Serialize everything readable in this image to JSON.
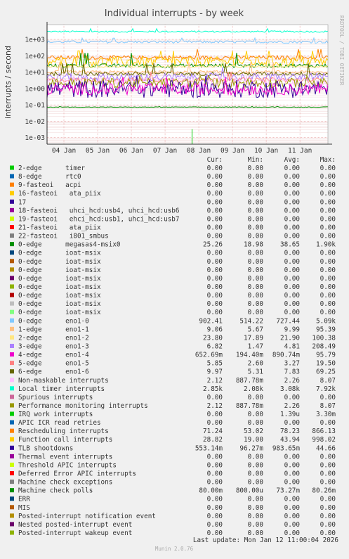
{
  "chart_data": {
    "type": "line",
    "title": "Individual interrupts - by week",
    "ylabel": "interrupts / second",
    "y_scale": "log",
    "ylim": [
      0.0004,
      8000
    ],
    "y_ticks": [
      {
        "value": 1000,
        "label": "1e+03"
      },
      {
        "value": 100,
        "label": "1e+02"
      },
      {
        "value": 10,
        "label": "1e+01"
      },
      {
        "value": 1,
        "label": "1e+00"
      },
      {
        "value": 0.1,
        "label": "1e-01"
      },
      {
        "value": 0.01,
        "label": "1e-02"
      },
      {
        "value": 0.001,
        "label": "1e-03"
      }
    ],
    "x_ticks": [
      {
        "value": 0.5,
        "label": "04 Jan"
      },
      {
        "value": 1.5,
        "label": "05 Jan"
      },
      {
        "value": 2.5,
        "label": "06 Jan"
      },
      {
        "value": 3.5,
        "label": "07 Jan"
      },
      {
        "value": 4.5,
        "label": "08 Jan"
      },
      {
        "value": 5.5,
        "label": "09 Jan"
      },
      {
        "value": 6.5,
        "label": "10 Jan"
      },
      {
        "value": 7.5,
        "label": "11 Jan"
      }
    ],
    "xlim": [
      0,
      8.33
    ],
    "grid": true,
    "side_label": "RRDTOOL / TOBI OETIKER",
    "column_headers": [
      "Cur:",
      "Min:",
      "Avg:",
      "Max:"
    ],
    "series": [
      {
        "name": "2-edge      timer",
        "color": "#00cc00",
        "cur": "0.00",
        "min": "0.00",
        "avg": "0.00",
        "max": "0.00"
      },
      {
        "name": "8-edge      rtc0",
        "color": "#0066b3",
        "cur": "0.00",
        "min": "0.00",
        "avg": "0.00",
        "max": "0.00"
      },
      {
        "name": "9-fasteoi   acpi",
        "color": "#ff8000",
        "cur": "0.00",
        "min": "0.00",
        "avg": "0.00",
        "max": "0.00"
      },
      {
        "name": "16-fasteoi   ata_piix",
        "color": "#ffcc00",
        "cur": "0.00",
        "min": "0.00",
        "avg": "0.00",
        "max": "0.00"
      },
      {
        "name": "17",
        "color": "#330099",
        "cur": "0.00",
        "min": "0.00",
        "avg": "0.00",
        "max": "0.00"
      },
      {
        "name": "18-fasteoi   uhci_hcd:usb4, uhci_hcd:usb6",
        "color": "#990099",
        "cur": "0.00",
        "min": "0.00",
        "avg": "0.00",
        "max": "0.00"
      },
      {
        "name": "19-fasteoi   ehci_hcd:usb1, uhci_hcd:usb7",
        "color": "#ccff00",
        "cur": "0.00",
        "min": "0.00",
        "avg": "0.00",
        "max": "0.00"
      },
      {
        "name": "21-fasteoi   ata_piix",
        "color": "#ff0000",
        "cur": "0.00",
        "min": "0.00",
        "avg": "0.00",
        "max": "0.00"
      },
      {
        "name": "22-fasteoi   i801_smbus",
        "color": "#808080",
        "cur": "0.00",
        "min": "0.00",
        "avg": "0.00",
        "max": "0.00"
      },
      {
        "name": "0-edge      megasas4-msix0",
        "color": "#008f00",
        "cur": "25.26",
        "min": "18.98",
        "avg": "38.65",
        "max": "1.90k"
      },
      {
        "name": "0-edge      ioat-msix",
        "color": "#00487d",
        "cur": "0.00",
        "min": "0.00",
        "avg": "0.00",
        "max": "0.00"
      },
      {
        "name": "0-edge      ioat-msix",
        "color": "#b35a00",
        "cur": "0.00",
        "min": "0.00",
        "avg": "0.00",
        "max": "0.00"
      },
      {
        "name": "0-edge      ioat-msix",
        "color": "#b38f00",
        "cur": "0.00",
        "min": "0.00",
        "avg": "0.00",
        "max": "0.00"
      },
      {
        "name": "0-edge      ioat-msix",
        "color": "#6b006b",
        "cur": "0.00",
        "min": "0.00",
        "avg": "0.00",
        "max": "0.00"
      },
      {
        "name": "0-edge      ioat-msix",
        "color": "#8fb300",
        "cur": "0.00",
        "min": "0.00",
        "avg": "0.00",
        "max": "0.00"
      },
      {
        "name": "0-edge      ioat-msix",
        "color": "#b30000",
        "cur": "0.00",
        "min": "0.00",
        "avg": "0.00",
        "max": "0.00"
      },
      {
        "name": "0-edge      ioat-msix",
        "color": "#bebebe",
        "cur": "0.00",
        "min": "0.00",
        "avg": "0.00",
        "max": "0.00"
      },
      {
        "name": "0-edge      ioat-msix",
        "color": "#80ff80",
        "cur": "0.00",
        "min": "0.00",
        "avg": "0.00",
        "max": "0.00"
      },
      {
        "name": "0-edge      eno1-0",
        "color": "#80c9ff",
        "cur": "902.41",
        "min": "514.22",
        "avg": "727.44",
        "max": "5.09k"
      },
      {
        "name": "1-edge      eno1-1",
        "color": "#ffc080",
        "cur": "9.06",
        "min": "5.67",
        "avg": "9.99",
        "max": "95.39"
      },
      {
        "name": "2-edge      eno1-2",
        "color": "#ffe680",
        "cur": "23.80",
        "min": "17.89",
        "avg": "21.90",
        "max": "100.38"
      },
      {
        "name": "3-edge      eno1-3",
        "color": "#aa80ff",
        "cur": "6.82",
        "min": "1.47",
        "avg": "4.81",
        "max": "208.49"
      },
      {
        "name": "4-edge      eno1-4",
        "color": "#ee00cc",
        "cur": "652.69m",
        "min": "194.40m",
        "avg": "890.74m",
        "max": "95.79"
      },
      {
        "name": "5-edge      eno1-5",
        "color": "#ff8080",
        "cur": "5.85",
        "min": "2.60",
        "avg": "3.27",
        "max": "19.50"
      },
      {
        "name": "6-edge      eno1-6",
        "color": "#666600",
        "cur": "9.97",
        "min": "5.31",
        "avg": "7.83",
        "max": "69.25"
      },
      {
        "name": "Non-maskable interrupts",
        "color": "#ffbfff",
        "cur": "2.12",
        "min": "887.78m",
        "avg": "2.26",
        "max": "8.07"
      },
      {
        "name": "Local timer interrupts",
        "color": "#00ffcc",
        "cur": "2.85k",
        "min": "2.08k",
        "avg": "3.08k",
        "max": "7.92k"
      },
      {
        "name": "Spurious interrupts",
        "color": "#cc6699",
        "cur": "0.00",
        "min": "0.00",
        "avg": "0.00",
        "max": "0.00"
      },
      {
        "name": "Performance monitoring interrupts",
        "color": "#999900",
        "cur": "2.12",
        "min": "887.78m",
        "avg": "2.26",
        "max": "8.07"
      },
      {
        "name": "IRQ work interrupts",
        "color": "#00cc00",
        "cur": "0.00",
        "min": "0.00",
        "avg": "1.39u",
        "max": "3.30m"
      },
      {
        "name": "APIC ICR read retries",
        "color": "#0066b3",
        "cur": "0.00",
        "min": "0.00",
        "avg": "0.00",
        "max": "0.00"
      },
      {
        "name": "Rescheduling interrupts",
        "color": "#ff8000",
        "cur": "71.24",
        "min": "53.02",
        "avg": "78.23",
        "max": "866.13"
      },
      {
        "name": "Function call interrupts",
        "color": "#ffcc00",
        "cur": "28.82",
        "min": "19.00",
        "avg": "43.94",
        "max": "998.02"
      },
      {
        "name": "TLB shootdowns",
        "color": "#330099",
        "cur": "553.14m",
        "min": "96.27m",
        "avg": "983.65m",
        "max": "44.66"
      },
      {
        "name": "Thermal event interrupts",
        "color": "#990099",
        "cur": "0.00",
        "min": "0.00",
        "avg": "0.00",
        "max": "0.00"
      },
      {
        "name": "Threshold APIC interrupts",
        "color": "#ccff00",
        "cur": "0.00",
        "min": "0.00",
        "avg": "0.00",
        "max": "0.00"
      },
      {
        "name": "Deferred Error APIC interrupts",
        "color": "#ff0000",
        "cur": "0.00",
        "min": "0.00",
        "avg": "0.00",
        "max": "0.00"
      },
      {
        "name": "Machine check exceptions",
        "color": "#808080",
        "cur": "0.00",
        "min": "0.00",
        "avg": "0.00",
        "max": "0.00"
      },
      {
        "name": "Machine check polls",
        "color": "#008f00",
        "cur": "80.00m",
        "min": "800.00u",
        "avg": "73.27m",
        "max": "80.26m"
      },
      {
        "name": "ERR",
        "color": "#00487d",
        "cur": "0.00",
        "min": "0.00",
        "avg": "0.00",
        "max": "0.00"
      },
      {
        "name": "MIS",
        "color": "#b35a00",
        "cur": "0.00",
        "min": "0.00",
        "avg": "0.00",
        "max": "0.00"
      },
      {
        "name": "Posted-interrupt notification event",
        "color": "#b38f00",
        "cur": "0.00",
        "min": "0.00",
        "avg": "0.00",
        "max": "0.00"
      },
      {
        "name": "Nested posted-interrupt event",
        "color": "#6b006b",
        "cur": "0.00",
        "min": "0.00",
        "avg": "0.00",
        "max": "0.00"
      },
      {
        "name": "Posted-interrupt wakeup event",
        "color": "#8fb300",
        "cur": "0.00",
        "min": "0.00",
        "avg": "0.00",
        "max": "0.00"
      }
    ],
    "plotted_levels": [
      {
        "series": "Local timer interrupts",
        "level": 3000,
        "jitter": 0.05,
        "spike_to": 4500
      },
      {
        "series": "0-edge      eno1-0",
        "level": 700,
        "jitter": 0.08,
        "spike_to": 1200
      },
      {
        "series": "Rescheduling interrupts",
        "level": 78,
        "jitter": 0.12,
        "spike_to": 250
      },
      {
        "series": "Function call interrupts",
        "level": 44,
        "jitter": 0.3,
        "spike_to": 200
      },
      {
        "series": "0-edge      megasas4-msix0",
        "level": 25,
        "jitter": 0.12,
        "spike_to": 150
      },
      {
        "series": "2-edge      eno1-2",
        "level": 22,
        "jitter": 0.06,
        "spike_to": 60
      },
      {
        "series": "1-edge      eno1-1",
        "level": 10,
        "jitter": 0.1,
        "spike_to": 40
      },
      {
        "series": "6-edge      eno1-6",
        "level": 8,
        "jitter": 0.12,
        "spike_to": 35
      },
      {
        "series": "3-edge      eno1-3",
        "level": 4.8,
        "jitter": 0.25,
        "spike_to": 20
      },
      {
        "series": "5-edge      eno1-5",
        "level": 3.3,
        "jitter": 0.15,
        "spike_to": 10
      },
      {
        "series": "Non-maskable interrupts",
        "level": 2.3,
        "jitter": 0.3,
        "spike_to": 6
      },
      {
        "series": "Performance monitoring interrupts",
        "level": 2.2,
        "jitter": 0.3,
        "spike_to": 6
      },
      {
        "series": "TLB shootdowns",
        "level": 0.95,
        "jitter": 0.55,
        "spike_to": 6
      },
      {
        "series": "4-edge      eno1-4",
        "level": 0.9,
        "jitter": 0.35,
        "spike_to": 5
      },
      {
        "series": "Machine check polls",
        "level": 0.073,
        "jitter": 0.02,
        "spike_to": 0.08
      },
      {
        "series": "IRQ work interrupts",
        "level": 0.0008,
        "jitter": 0,
        "spike_to": 0.0033,
        "spike_only": true
      }
    ],
    "last_update": "Last update: Mon Jan 12 11:00:04 2026",
    "footer": "Munin 2.0.76"
  }
}
